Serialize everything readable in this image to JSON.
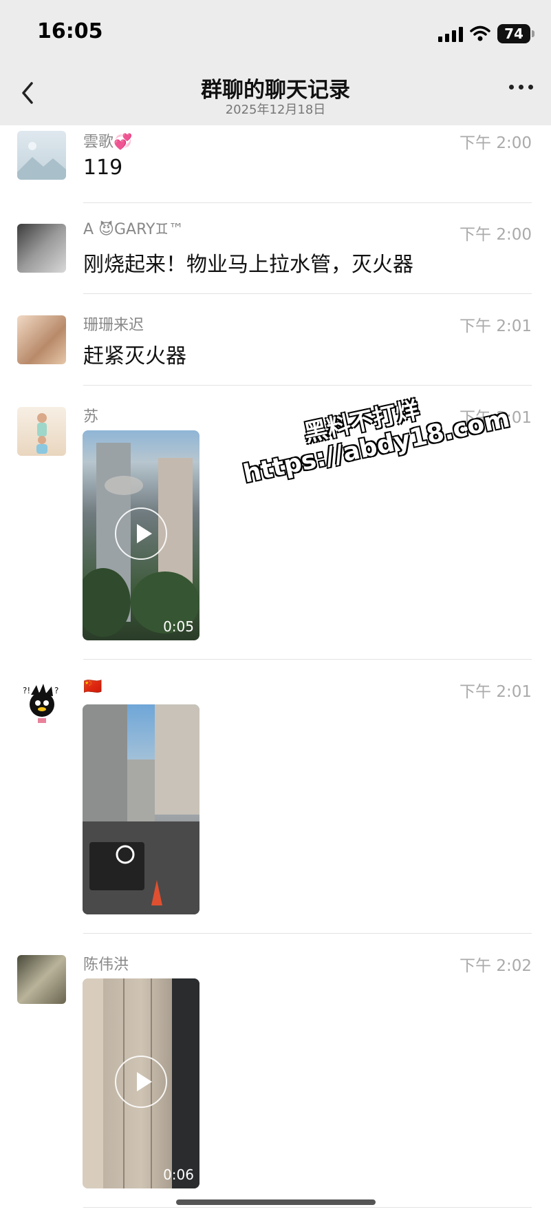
{
  "status": {
    "time": "16:05",
    "battery": "74"
  },
  "nav": {
    "title": "群聊的聊天记录",
    "subtitle": "2025年12月18日"
  },
  "messages": [
    {
      "sender": "雲歌💞",
      "time": "下午 2:00",
      "text": "119"
    },
    {
      "sender": "A 😈GARY♊™",
      "time": "下午 2:00",
      "text": "刚烧起来！物业马上拉水管，灭火器"
    },
    {
      "sender": "珊珊来迟",
      "time": "下午 2:01",
      "text": "赶紧灭火器"
    },
    {
      "sender": "苏",
      "time": "下午 2:01",
      "video_duration": "0:05"
    },
    {
      "sender": "🇨🇳",
      "time": "下午 2:01"
    },
    {
      "sender": "陈伟洪",
      "time": "下午 2:02",
      "video_duration": "0:06"
    }
  ],
  "watermark": {
    "line1": "黑料不打烊",
    "line2": "https://abdy18.com"
  },
  "colors": {
    "bar_bg": "#ececec",
    "timestamp": "#aaaaaa",
    "sender": "#888888"
  },
  "icons": [
    "back-chevron-icon",
    "more-dots-icon",
    "signal-icon",
    "wifi-icon",
    "battery-icon",
    "play-icon"
  ]
}
